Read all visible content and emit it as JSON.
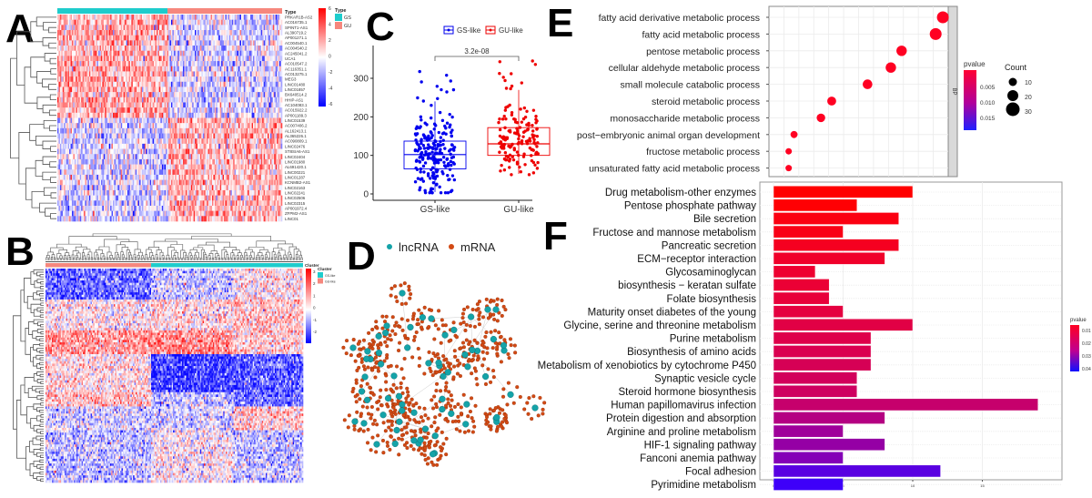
{
  "panels": {
    "A": {
      "letter": "A",
      "annotation_label": "Type",
      "legend_title": "Type",
      "legend": [
        {
          "label": "GS",
          "color": "#1ECCCC"
        },
        {
          "label": "GU",
          "color": "#F6877D"
        }
      ],
      "colorbar_ticks": [
        "6",
        "4",
        "2",
        "0",
        "-2",
        "-4",
        "-6"
      ],
      "genes": [
        "PRKAR1B-AS2",
        "AC016735.1",
        "SPINT1-AS1",
        "AL390719.2",
        "AP001271.1",
        "AC004540.1",
        "AC004540.2",
        "AC245041.2",
        "UCA1",
        "AC010547.2",
        "AC116351.1",
        "AC013275.1",
        "MEG3",
        "LINC01480",
        "LINC01857",
        "BX640514.2",
        "HHIP-AS1",
        "AC104083.1",
        "AC015922.2",
        "AP001189.3",
        "LINC01539",
        "AC007406.2",
        "AL162413.1",
        "AL365226.1",
        "AC090809.1",
        "LINC02476",
        "ST8SIA6-AS1",
        "LINC02404",
        "LINC01980",
        "AL691420.1",
        "LINC00221",
        "LINC01287",
        "KCNMB2-AS1",
        "LINC02163",
        "LINC02241",
        "LINC02506",
        "LINC02315",
        "AP001972.4",
        "ZFPM2-AS1",
        "LINC01"
      ],
      "group_split": 0.49
    },
    "B": {
      "letter": "B",
      "annotation_label": "Cluster",
      "legend_title": "Cluster",
      "legend": [
        {
          "label": "GS-like",
          "color": "#1ECCCC"
        },
        {
          "label": "GU-like",
          "color": "#F6877D"
        }
      ],
      "colorbar_ticks": [
        "3",
        "2",
        "1",
        "0",
        "-1",
        "-2"
      ],
      "group_split": 0.41
    },
    "C": {
      "letter": "C",
      "legend": [
        {
          "label": "GS-like",
          "color": "#0000EE"
        },
        {
          "label": "GU-like",
          "color": "#EE0000"
        }
      ],
      "pvalue_label": "3.2e-08"
    },
    "D": {
      "letter": "D",
      "legend": [
        {
          "label": "lncRNA",
          "color": "#14A3A8"
        },
        {
          "label": "mRNA",
          "color": "#D24A14"
        }
      ]
    },
    "E": {
      "letter": "E",
      "facet_label": "BP",
      "legend_pvalue_title": "pvalue",
      "legend_pvalue_ticks": [
        "0.005",
        "0.010",
        "0.015"
      ],
      "legend_count_title": "Count",
      "legend_count_ticks": [
        "10",
        "20",
        "30"
      ]
    },
    "F": {
      "letter": "F",
      "legend_title": "pvalue",
      "legend_ticks": [
        "0.01",
        "0.02",
        "0.03",
        "0.04"
      ]
    }
  },
  "chart_data": [
    {
      "panel": "C",
      "type": "box",
      "title": "",
      "xlabel": "",
      "ylabel": "",
      "categories": [
        "GS-like",
        "GU-like"
      ],
      "ylim": [
        -10,
        370
      ],
      "yticks": [
        0,
        100,
        200,
        300
      ],
      "series": [
        {
          "name": "GS-like",
          "color": "#0000EE",
          "q1": 65,
          "median": 102,
          "q3": 137,
          "whisker_low": 5,
          "whisker_high": 240,
          "n_points": 220
        },
        {
          "name": "GU-like",
          "color": "#EE0000",
          "q1": 100,
          "median": 130,
          "q3": 172,
          "whisker_low": 52,
          "whisker_high": 270,
          "n_points": 150
        }
      ],
      "annotation": "3.2e-08"
    },
    {
      "panel": "E",
      "type": "scatter",
      "title": "",
      "facet": "BP",
      "categories": [
        "fatty acid derivative metabolic process",
        "fatty acid metabolic process",
        "pentose metabolic process",
        "cellular aldehyde metabolic process",
        "small molecule catabolic process",
        "steroid metabolic process",
        "monosaccharide metabolic process",
        "post−embryonic animal organ development",
        "fructose metabolic process",
        "unsaturated fatty acid metabolic process"
      ],
      "x_relative": [
        0.97,
        0.93,
        0.74,
        0.68,
        0.55,
        0.35,
        0.29,
        0.14,
        0.11,
        0.11
      ],
      "count": [
        30,
        30,
        26,
        26,
        24,
        22,
        21,
        17,
        15,
        15
      ],
      "pvalue": [
        0.0005,
        0.0005,
        0.0006,
        0.0006,
        0.0007,
        0.0008,
        0.0008,
        0.0009,
        0.0009,
        0.0009
      ],
      "legend": {
        "pvalue_range": [
          0,
          0.018
        ],
        "count_ticks": [
          10,
          20,
          30
        ]
      }
    },
    {
      "panel": "F",
      "type": "bar",
      "orientation": "horizontal",
      "title": "",
      "categories": [
        "Drug metabolism-other enzymes",
        "Pentose phosphate pathway",
        "Bile secretion",
        "Fructose and mannose metabolism",
        "Pancreatic secretion",
        "ECM−receptor interaction",
        "Glycosaminoglycan",
        "biosynthesis − keratan sulfate",
        "Folate biosynthesis",
        "Maturity onset diabetes of the young",
        "Glycine, serine and threonine metabolism",
        "Purine metabolism",
        "Biosynthesis of amino acids",
        "Metabolism of xenobiotics by cytochrome P450",
        "Synaptic vesicle cycle",
        "Steroid hormone biosynthesis",
        "Human papillomavirus infection",
        "Protein digestion and absorption",
        "Arginine and proline metabolism",
        "HIF-1 signaling pathway",
        "Fanconi anemia pathway",
        "Focal adhesion",
        "Pyrimidine metabolism"
      ],
      "values": [
        10,
        6,
        9,
        5,
        9,
        8,
        3,
        4,
        4,
        5,
        10,
        7,
        7,
        7,
        6,
        6,
        19,
        8,
        5,
        8,
        5,
        12,
        5
      ],
      "pvalue": [
        0.001,
        0.002,
        0.005,
        0.006,
        0.008,
        0.01,
        0.011,
        0.012,
        0.013,
        0.014,
        0.015,
        0.016,
        0.017,
        0.018,
        0.019,
        0.02,
        0.022,
        0.026,
        0.03,
        0.032,
        0.035,
        0.042,
        0.046
      ],
      "xlim": [
        -1,
        20
      ],
      "xticks": [
        0,
        5,
        10,
        15
      ],
      "legend": {
        "title": "pvalue",
        "range": [
          0.005,
          0.048
        ]
      }
    }
  ]
}
